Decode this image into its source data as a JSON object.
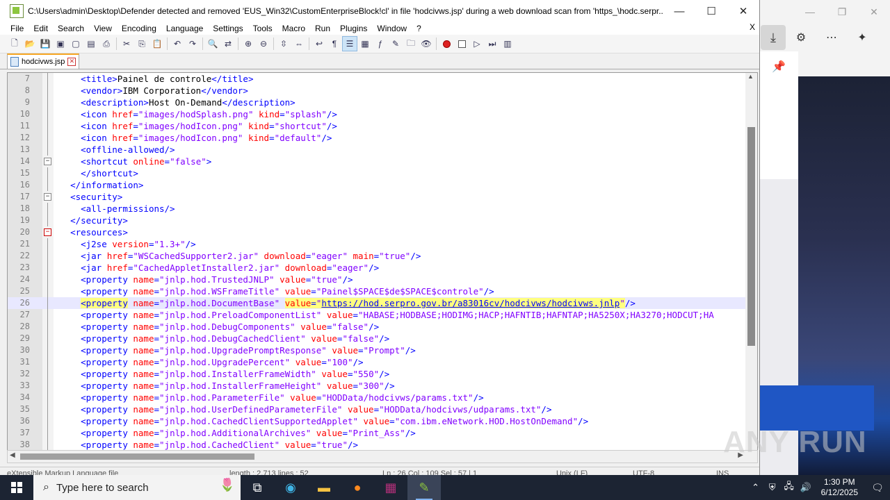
{
  "window": {
    "title": "C:\\Users\\admin\\Desktop\\Defender detected and removed 'EUS_Win32\\CustomEnterpriseBlock!cl' in file 'hodcivws.jsp' during a web download scan from 'https_\\hodc.serpr...",
    "min": "—",
    "max": "☐",
    "close": "✕"
  },
  "menu": [
    "File",
    "Edit",
    "Search",
    "View",
    "Encoding",
    "Language",
    "Settings",
    "Tools",
    "Macro",
    "Run",
    "Plugins",
    "Window",
    "?"
  ],
  "menu_close": "X",
  "tab": {
    "label": "hodcivws.jsp",
    "close": "✕"
  },
  "lines": [
    {
      "n": "7",
      "parts": [
        [
          "ind",
          "    "
        ],
        [
          "tg",
          "<title>"
        ],
        [
          "tx",
          "Painel de controle"
        ],
        [
          "tg",
          "</title>"
        ]
      ]
    },
    {
      "n": "8",
      "parts": [
        [
          "ind",
          "    "
        ],
        [
          "tg",
          "<vendor>"
        ],
        [
          "tx",
          "IBM Corporation"
        ],
        [
          "tg",
          "</vendor>"
        ]
      ]
    },
    {
      "n": "9",
      "parts": [
        [
          "ind",
          "    "
        ],
        [
          "tg",
          "<description>"
        ],
        [
          "tx",
          "Host On-Demand"
        ],
        [
          "tg",
          "</description>"
        ]
      ]
    },
    {
      "n": "10",
      "parts": [
        [
          "ind",
          "    "
        ],
        [
          "tg",
          "<icon "
        ],
        [
          "at",
          "href"
        ],
        [
          "tg",
          "="
        ],
        [
          "av",
          "\"images/hodSplash.png\""
        ],
        [
          "tg",
          " "
        ],
        [
          "at",
          "kind"
        ],
        [
          "tg",
          "="
        ],
        [
          "av",
          "\"splash\""
        ],
        [
          "tg",
          "/>"
        ]
      ]
    },
    {
      "n": "11",
      "parts": [
        [
          "ind",
          "    "
        ],
        [
          "tg",
          "<icon "
        ],
        [
          "at",
          "href"
        ],
        [
          "tg",
          "="
        ],
        [
          "av",
          "\"images/hodIcon.png\""
        ],
        [
          "tg",
          " "
        ],
        [
          "at",
          "kind"
        ],
        [
          "tg",
          "="
        ],
        [
          "av",
          "\"shortcut\""
        ],
        [
          "tg",
          "/>"
        ]
      ]
    },
    {
      "n": "12",
      "parts": [
        [
          "ind",
          "    "
        ],
        [
          "tg",
          "<icon "
        ],
        [
          "at",
          "href"
        ],
        [
          "tg",
          "="
        ],
        [
          "av",
          "\"images/hodIcon.png\""
        ],
        [
          "tg",
          " "
        ],
        [
          "at",
          "kind"
        ],
        [
          "tg",
          "="
        ],
        [
          "av",
          "\"default\""
        ],
        [
          "tg",
          "/>"
        ]
      ]
    },
    {
      "n": "13",
      "parts": [
        [
          "ind",
          "    "
        ],
        [
          "tg",
          "<offline-allowed/>"
        ]
      ]
    },
    {
      "n": "14",
      "fold": "minus",
      "parts": [
        [
          "ind",
          "    "
        ],
        [
          "tg",
          "<shortcut "
        ],
        [
          "at",
          "online"
        ],
        [
          "tg",
          "="
        ],
        [
          "av",
          "\"false\""
        ],
        [
          "tg",
          ">"
        ]
      ]
    },
    {
      "n": "15",
      "parts": [
        [
          "ind",
          "    "
        ],
        [
          "tg",
          "</shortcut>"
        ]
      ]
    },
    {
      "n": "16",
      "parts": [
        [
          "ind",
          "  "
        ],
        [
          "tg",
          "</information>"
        ]
      ]
    },
    {
      "n": "17",
      "fold": "minus",
      "parts": [
        [
          "ind",
          "  "
        ],
        [
          "tg",
          "<security>"
        ]
      ]
    },
    {
      "n": "18",
      "parts": [
        [
          "ind",
          "    "
        ],
        [
          "tg",
          "<all-permissions/>"
        ]
      ]
    },
    {
      "n": "19",
      "parts": [
        [
          "ind",
          "  "
        ],
        [
          "tg",
          "</security>"
        ]
      ]
    },
    {
      "n": "20",
      "fold": "minus-red",
      "parts": [
        [
          "ind",
          "  "
        ],
        [
          "tg",
          "<resources>"
        ]
      ]
    },
    {
      "n": "21",
      "parts": [
        [
          "ind",
          "    "
        ],
        [
          "tg",
          "<j2se "
        ],
        [
          "at",
          "version"
        ],
        [
          "tg",
          "="
        ],
        [
          "av",
          "\"1.3+\""
        ],
        [
          "tg",
          "/>"
        ]
      ]
    },
    {
      "n": "22",
      "parts": [
        [
          "ind",
          "    "
        ],
        [
          "tg",
          "<jar "
        ],
        [
          "at",
          "href"
        ],
        [
          "tg",
          "="
        ],
        [
          "av",
          "\"WSCachedSupporter2.jar\""
        ],
        [
          "tg",
          " "
        ],
        [
          "at",
          "download"
        ],
        [
          "tg",
          "="
        ],
        [
          "av",
          "\"eager\""
        ],
        [
          "tg",
          " "
        ],
        [
          "at",
          "main"
        ],
        [
          "tg",
          "="
        ],
        [
          "av",
          "\"true\""
        ],
        [
          "tg",
          "/>"
        ]
      ]
    },
    {
      "n": "23",
      "parts": [
        [
          "ind",
          "    "
        ],
        [
          "tg",
          "<jar "
        ],
        [
          "at",
          "href"
        ],
        [
          "tg",
          "="
        ],
        [
          "av",
          "\"CachedAppletInstaller2.jar\""
        ],
        [
          "tg",
          " "
        ],
        [
          "at",
          "download"
        ],
        [
          "tg",
          "="
        ],
        [
          "av",
          "\"eager\""
        ],
        [
          "tg",
          "/>"
        ]
      ]
    },
    {
      "n": "24",
      "parts": [
        [
          "ind",
          "    "
        ],
        [
          "tg",
          "<property "
        ],
        [
          "at",
          "name"
        ],
        [
          "tg",
          "="
        ],
        [
          "av",
          "\"jnlp.hod.TrustedJNLP\""
        ],
        [
          "tg",
          " "
        ],
        [
          "at",
          "value"
        ],
        [
          "tg",
          "="
        ],
        [
          "av",
          "\"true\""
        ],
        [
          "tg",
          "/>"
        ]
      ]
    },
    {
      "n": "25",
      "parts": [
        [
          "ind",
          "    "
        ],
        [
          "tg",
          "<property "
        ],
        [
          "at",
          "name"
        ],
        [
          "tg",
          "="
        ],
        [
          "av",
          "\"jnlp.hod.WSFrameTitle\""
        ],
        [
          "tg",
          " "
        ],
        [
          "at",
          "value"
        ],
        [
          "tg",
          "="
        ],
        [
          "av",
          "\"Painel$SPACE$de$SPACE$controle\""
        ],
        [
          "tg",
          "/>"
        ]
      ]
    },
    {
      "n": "26",
      "current": true,
      "parts": [
        [
          "ind",
          "    "
        ],
        [
          "tg hl",
          "<property"
        ],
        [
          "tg",
          " "
        ],
        [
          "at",
          "name"
        ],
        [
          "tg",
          "="
        ],
        [
          "av",
          "\"jnlp.hod.DocumentBase\""
        ],
        [
          "tg",
          " "
        ],
        [
          "at hl",
          "value"
        ],
        [
          "tg hl",
          "="
        ],
        [
          "av hl",
          "\""
        ],
        [
          "av hl ul",
          "https://hod.serpro.gov.br/a83016cv/hodcivws/hodcivws.jnlp"
        ],
        [
          "av hl",
          "\""
        ],
        [
          "tg",
          "/>"
        ]
      ]
    },
    {
      "n": "27",
      "parts": [
        [
          "ind",
          "    "
        ],
        [
          "tg",
          "<property "
        ],
        [
          "at",
          "name"
        ],
        [
          "tg",
          "="
        ],
        [
          "av",
          "\"jnlp.hod.PreloadComponentList\""
        ],
        [
          "tg",
          " "
        ],
        [
          "at",
          "value"
        ],
        [
          "tg",
          "="
        ],
        [
          "av",
          "\"HABASE;HODBASE;HODIMG;HACP;HAFNTIB;HAFNTAP;HA5250X;HA3270;HODCUT;HA"
        ]
      ]
    },
    {
      "n": "28",
      "parts": [
        [
          "ind",
          "    "
        ],
        [
          "tg",
          "<property "
        ],
        [
          "at",
          "name"
        ],
        [
          "tg",
          "="
        ],
        [
          "av",
          "\"jnlp.hod.DebugComponents\""
        ],
        [
          "tg",
          " "
        ],
        [
          "at",
          "value"
        ],
        [
          "tg",
          "="
        ],
        [
          "av",
          "\"false\""
        ],
        [
          "tg",
          "/>"
        ]
      ]
    },
    {
      "n": "29",
      "parts": [
        [
          "ind",
          "    "
        ],
        [
          "tg",
          "<property "
        ],
        [
          "at",
          "name"
        ],
        [
          "tg",
          "="
        ],
        [
          "av",
          "\"jnlp.hod.DebugCachedClient\""
        ],
        [
          "tg",
          " "
        ],
        [
          "at",
          "value"
        ],
        [
          "tg",
          "="
        ],
        [
          "av",
          "\"false\""
        ],
        [
          "tg",
          "/>"
        ]
      ]
    },
    {
      "n": "30",
      "parts": [
        [
          "ind",
          "    "
        ],
        [
          "tg",
          "<property "
        ],
        [
          "at",
          "name"
        ],
        [
          "tg",
          "="
        ],
        [
          "av",
          "\"jnlp.hod.UpgradePromptResponse\""
        ],
        [
          "tg",
          " "
        ],
        [
          "at",
          "value"
        ],
        [
          "tg",
          "="
        ],
        [
          "av",
          "\"Prompt\""
        ],
        [
          "tg",
          "/>"
        ]
      ]
    },
    {
      "n": "31",
      "parts": [
        [
          "ind",
          "    "
        ],
        [
          "tg",
          "<property "
        ],
        [
          "at",
          "name"
        ],
        [
          "tg",
          "="
        ],
        [
          "av",
          "\"jnlp.hod.UpgradePercent\""
        ],
        [
          "tg",
          " "
        ],
        [
          "at",
          "value"
        ],
        [
          "tg",
          "="
        ],
        [
          "av",
          "\"100\""
        ],
        [
          "tg",
          "/>"
        ]
      ]
    },
    {
      "n": "32",
      "parts": [
        [
          "ind",
          "    "
        ],
        [
          "tg",
          "<property "
        ],
        [
          "at",
          "name"
        ],
        [
          "tg",
          "="
        ],
        [
          "av",
          "\"jnlp.hod.InstallerFrameWidth\""
        ],
        [
          "tg",
          " "
        ],
        [
          "at",
          "value"
        ],
        [
          "tg",
          "="
        ],
        [
          "av",
          "\"550\""
        ],
        [
          "tg",
          "/>"
        ]
      ]
    },
    {
      "n": "33",
      "parts": [
        [
          "ind",
          "    "
        ],
        [
          "tg",
          "<property "
        ],
        [
          "at",
          "name"
        ],
        [
          "tg",
          "="
        ],
        [
          "av",
          "\"jnlp.hod.InstallerFrameHeight\""
        ],
        [
          "tg",
          " "
        ],
        [
          "at",
          "value"
        ],
        [
          "tg",
          "="
        ],
        [
          "av",
          "\"300\""
        ],
        [
          "tg",
          "/>"
        ]
      ]
    },
    {
      "n": "34",
      "parts": [
        [
          "ind",
          "    "
        ],
        [
          "tg",
          "<property "
        ],
        [
          "at",
          "name"
        ],
        [
          "tg",
          "="
        ],
        [
          "av",
          "\"jnlp.hod.ParameterFile\""
        ],
        [
          "tg",
          " "
        ],
        [
          "at",
          "value"
        ],
        [
          "tg",
          "="
        ],
        [
          "av",
          "\"HODData/hodcivws/params.txt\""
        ],
        [
          "tg",
          "/>"
        ]
      ]
    },
    {
      "n": "35",
      "parts": [
        [
          "ind",
          "    "
        ],
        [
          "tg",
          "<property "
        ],
        [
          "at",
          "name"
        ],
        [
          "tg",
          "="
        ],
        [
          "av",
          "\"jnlp.hod.UserDefinedParameterFile\""
        ],
        [
          "tg",
          " "
        ],
        [
          "at",
          "value"
        ],
        [
          "tg",
          "="
        ],
        [
          "av",
          "\"HODData/hodcivws/udparams.txt\""
        ],
        [
          "tg",
          "/>"
        ]
      ]
    },
    {
      "n": "36",
      "parts": [
        [
          "ind",
          "    "
        ],
        [
          "tg",
          "<property "
        ],
        [
          "at",
          "name"
        ],
        [
          "tg",
          "="
        ],
        [
          "av",
          "\"jnlp.hod.CachedClientSupportedApplet\""
        ],
        [
          "tg",
          " "
        ],
        [
          "at",
          "value"
        ],
        [
          "tg",
          "="
        ],
        [
          "av",
          "\"com.ibm.eNetwork.HOD.HostOnDemand\""
        ],
        [
          "tg",
          "/>"
        ]
      ]
    },
    {
      "n": "37",
      "parts": [
        [
          "ind",
          "    "
        ],
        [
          "tg",
          "<property "
        ],
        [
          "at",
          "name"
        ],
        [
          "tg",
          "="
        ],
        [
          "av",
          "\"jnlp.hod.AdditionalArchives\""
        ],
        [
          "tg",
          " "
        ],
        [
          "at",
          "value"
        ],
        [
          "tg",
          "="
        ],
        [
          "av",
          "\"Print_Ass\""
        ],
        [
          "tg",
          "/>"
        ]
      ]
    },
    {
      "n": "38",
      "parts": [
        [
          "ind",
          "    "
        ],
        [
          "tg",
          "<property "
        ],
        [
          "at",
          "name"
        ],
        [
          "tg",
          "="
        ],
        [
          "av",
          "\"jnlp.hod.CachedClient\""
        ],
        [
          "tg",
          " "
        ],
        [
          "at",
          "value"
        ],
        [
          "tg",
          "="
        ],
        [
          "av",
          "\"true\""
        ],
        [
          "tg",
          "/>"
        ]
      ]
    }
  ],
  "status": {
    "type": "eXtensible Markup Language file",
    "length": "length : 2,713    lines : 52",
    "pos": "Ln : 26    Col : 109    Sel : 57 | 1",
    "eol": "Unix (LF)",
    "enc": "UTF-8",
    "mode": "INS"
  },
  "watermark": "ANY RUN",
  "taskbar": {
    "search_placeholder": "Type here to search",
    "time": "1:30 PM",
    "date": "6/12/2025"
  }
}
